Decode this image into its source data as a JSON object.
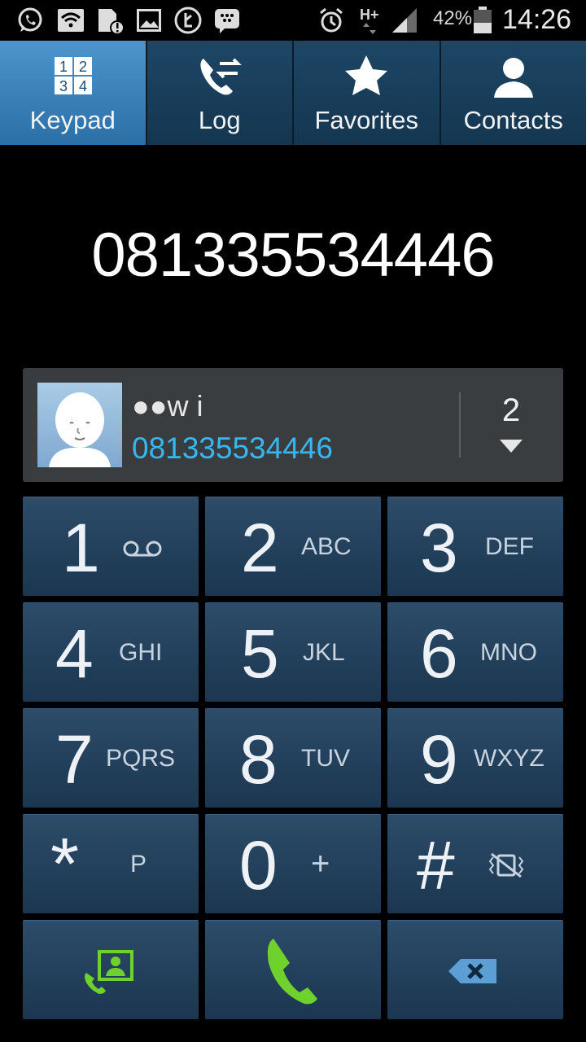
{
  "status_bar": {
    "battery": "42%",
    "time": "14:26",
    "network": "H+"
  },
  "tabs": [
    {
      "label": "Keypad",
      "icon": "keypad-icon",
      "active": true
    },
    {
      "label": "Log",
      "icon": "call-log-icon",
      "active": false
    },
    {
      "label": "Favorites",
      "icon": "star-icon",
      "active": false
    },
    {
      "label": "Contacts",
      "icon": "contact-person-icon",
      "active": false
    }
  ],
  "dialer": {
    "number": "081335534446"
  },
  "suggestion": {
    "name": "●●w i",
    "number": "081335534446",
    "count": "2"
  },
  "keypad": [
    {
      "digit": "1",
      "letters": ""
    },
    {
      "digit": "2",
      "letters": "ABC"
    },
    {
      "digit": "3",
      "letters": "DEF"
    },
    {
      "digit": "4",
      "letters": "GHI"
    },
    {
      "digit": "5",
      "letters": "JKL"
    },
    {
      "digit": "6",
      "letters": "MNO"
    },
    {
      "digit": "7",
      "letters": "PQRS"
    },
    {
      "digit": "8",
      "letters": "TUV"
    },
    {
      "digit": "9",
      "letters": "WXYZ"
    },
    {
      "digit": "*",
      "letters": "P"
    },
    {
      "digit": "0",
      "letters": "+"
    },
    {
      "digit": "#",
      "letters": ""
    }
  ],
  "colors": {
    "accent": "#38b7ef",
    "call_green": "#6fd12b",
    "active_tab": "#3d84bf"
  }
}
